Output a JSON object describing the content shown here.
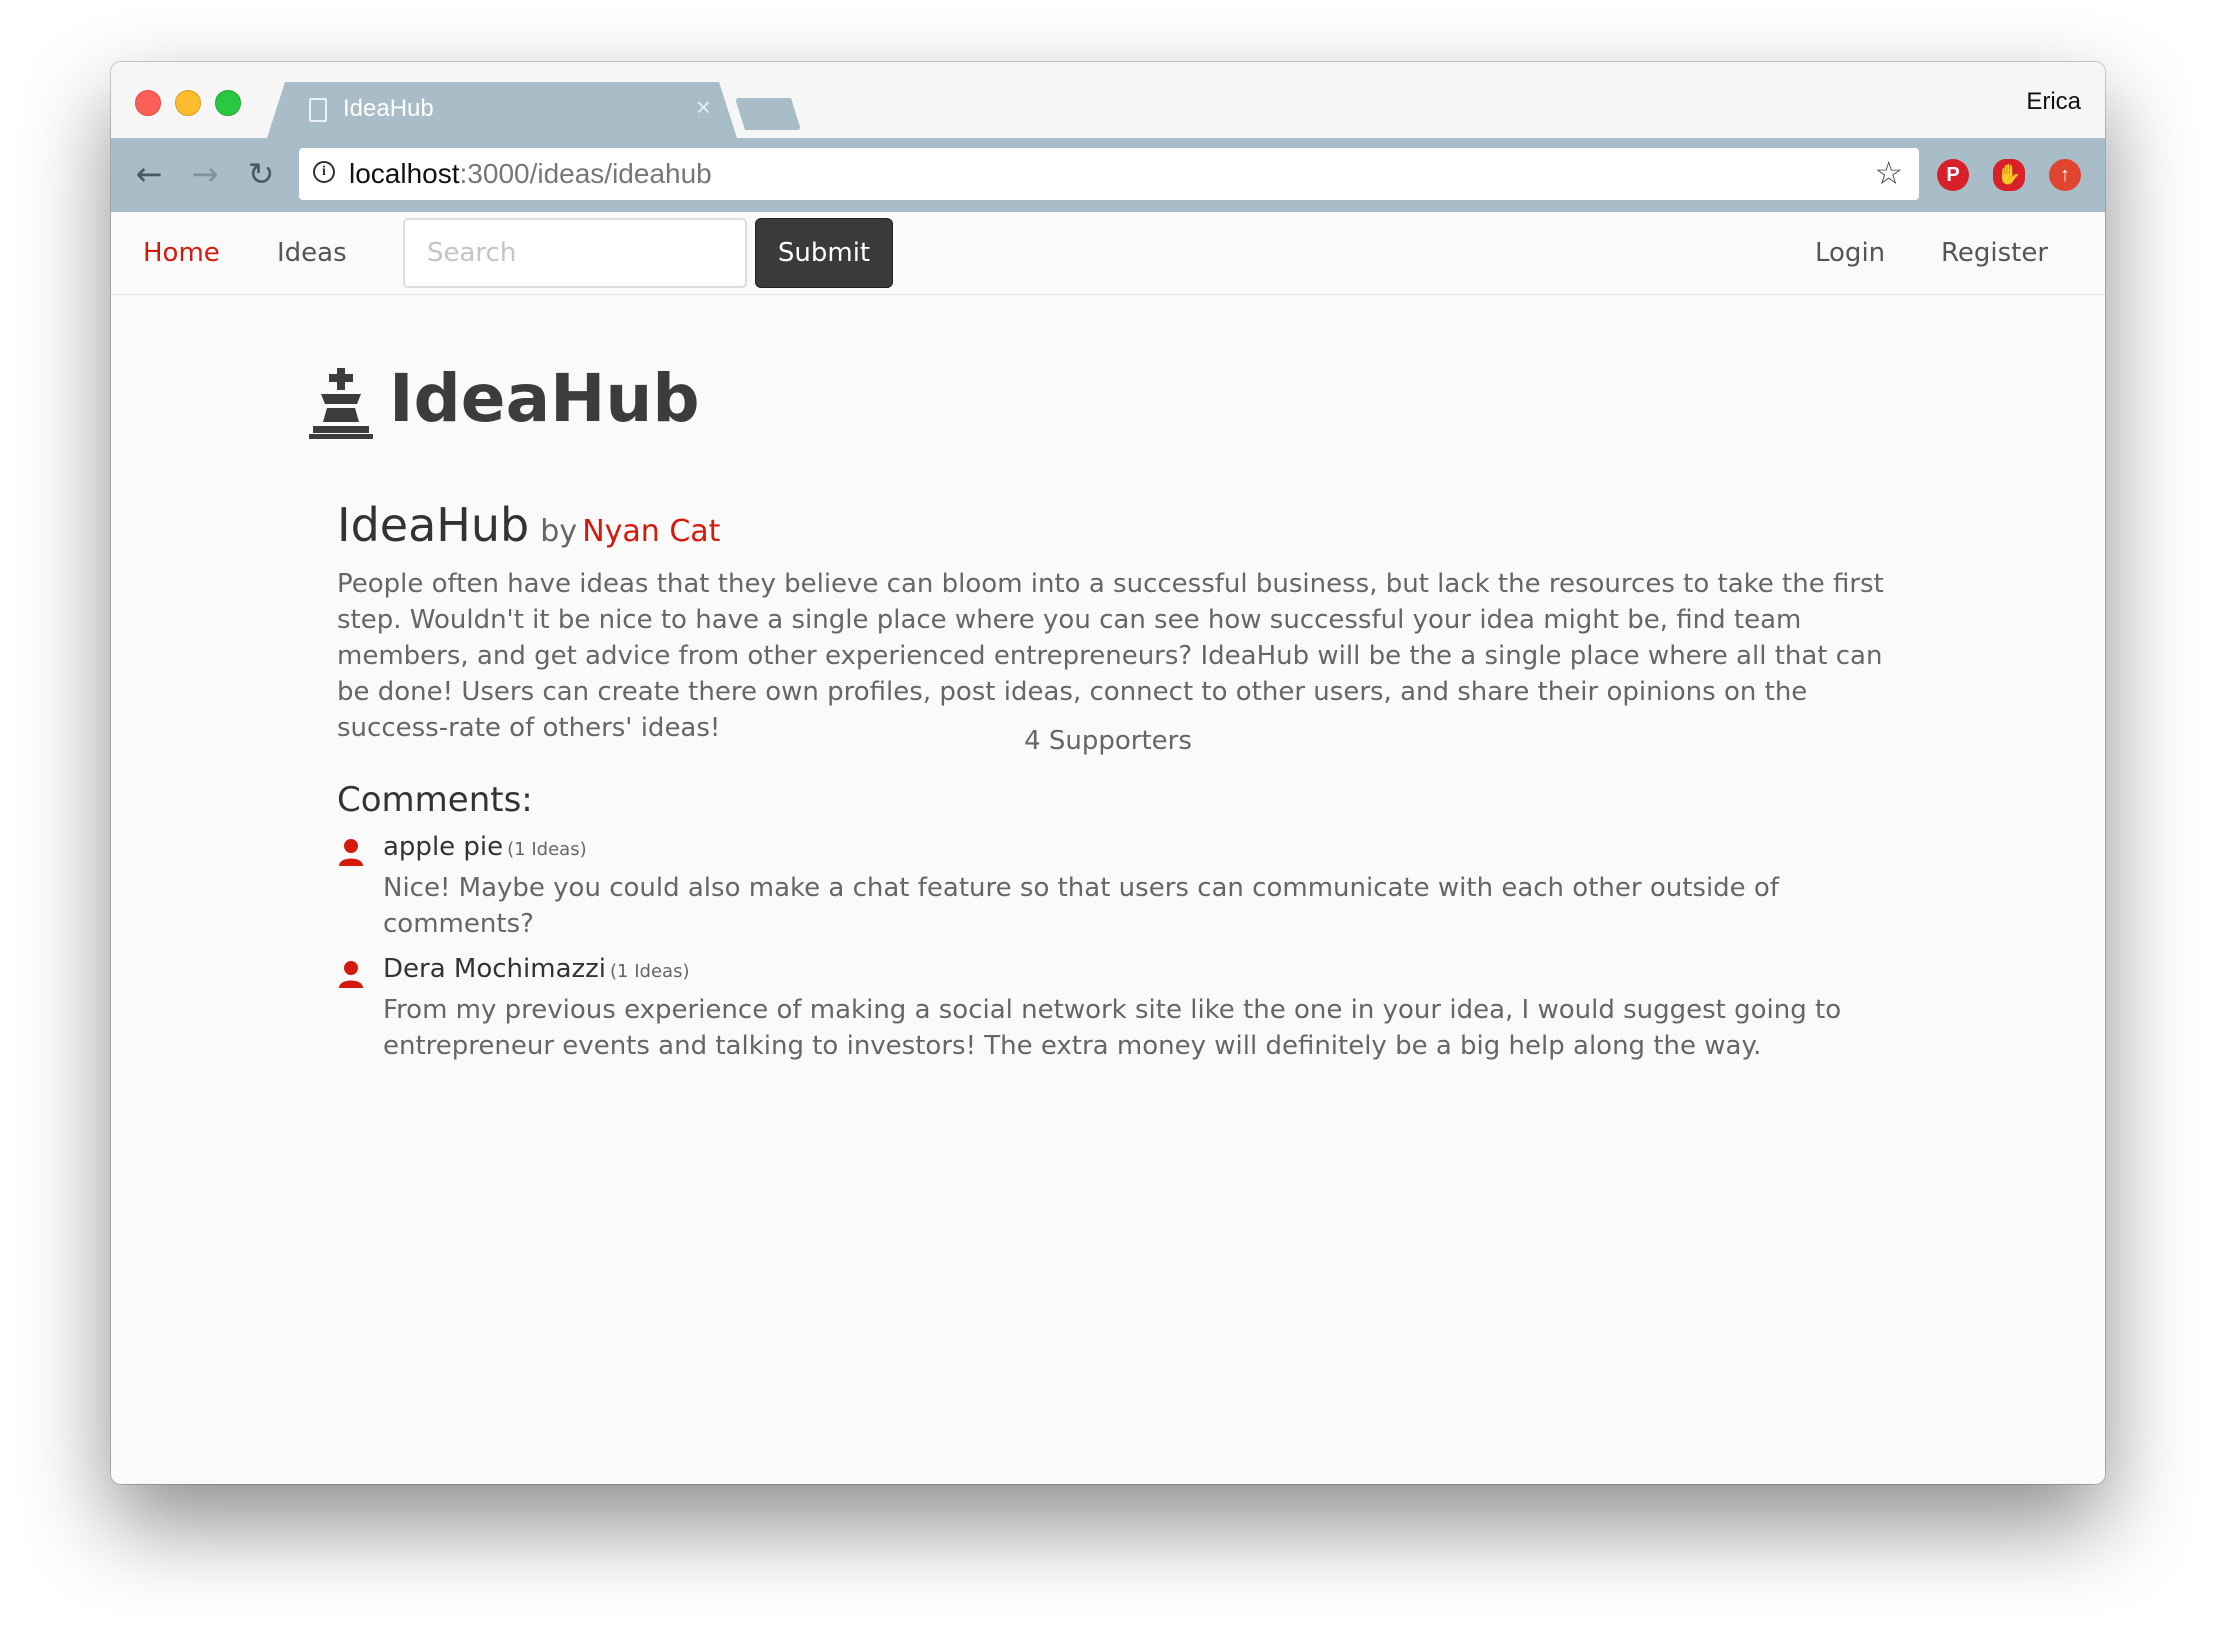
{
  "browser": {
    "tab_title": "IdeaHub",
    "tab_close": "×",
    "profile_name": "Erica",
    "url_host": "localhost",
    "url_path": ":3000/ideas/ideahub",
    "nav_back": "←",
    "nav_forward": "→",
    "nav_reload": "↻",
    "info": "i",
    "star": "☆",
    "extensions": [
      {
        "name": "pinterest-extension",
        "glyph": "P"
      },
      {
        "name": "stop-extension",
        "glyph": "✋"
      },
      {
        "name": "upload-extension",
        "glyph": "↑"
      }
    ]
  },
  "nav": {
    "home": "Home",
    "ideas": "Ideas",
    "search_placeholder": "Search",
    "submit": "Submit",
    "login": "Login",
    "register": "Register"
  },
  "brand": {
    "title": "IdeaHub",
    "icon": "chess-king-icon"
  },
  "idea": {
    "title": "IdeaHub",
    "by": "by",
    "author": "Nyan Cat",
    "description": "People often have ideas that they believe can bloom into a successful business, but lack the resources to take the first step. Wouldn't it be nice to have a single place where you can see how successful your idea might be, find team members, and get advice from other experienced entrepreneurs? IdeaHub will be the a single place where all that can be done! Users can create there own profiles, post ideas, connect to other users, and share their opinions on the success-rate of others' ideas!",
    "supporters": "4 Supporters"
  },
  "comments": {
    "heading": "Comments:",
    "items": [
      {
        "author": "apple pie",
        "ideas_count": "(1 Ideas)",
        "text": "Nice! Maybe you could also make a chat feature so that users can communicate with each other outside of comments?"
      },
      {
        "author": "Dera Mochimazzi",
        "ideas_count": "(1 Ideas)",
        "text": "From my previous experience of making a social network site like the one in your idea, I would suggest going to entrepreneur events and talking to investors! The extra money will definitely be a big help along the way."
      }
    ]
  },
  "colors": {
    "accent": "#d51a0b",
    "chrome_tab": "#a8bdc7",
    "submit_bg": "#3a3a3a"
  }
}
